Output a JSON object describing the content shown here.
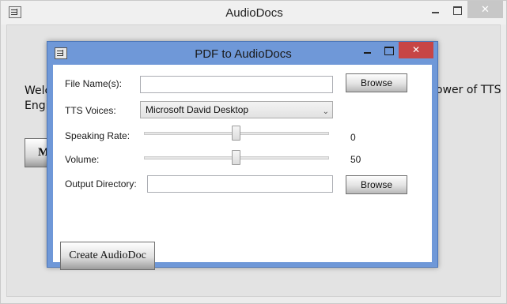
{
  "main": {
    "title": "AudioDocs",
    "close_glyph": "✕",
    "welcome_left": "Welco",
    "welcome_left_line2": "Engi",
    "welcome_right": "ower of TTS",
    "button_label": "M"
  },
  "dialog": {
    "title": "PDF to AudioDocs",
    "close_glyph": "✕",
    "file_label": "File Name(s):",
    "file_value": "",
    "browse_label": "Browse",
    "voices_label": "TTS Voices:",
    "voice_selected": "Microsoft David Desktop",
    "voice_chevron": "⌄",
    "rate_label": "Speaking Rate:",
    "rate_value": "0",
    "volume_label": "Volume:",
    "volume_value": "50",
    "output_label": "Output Directory:",
    "output_value": "",
    "browse2_label": "Browse",
    "create_label": "Create AudioDoc"
  },
  "colors": {
    "dialog_frame": "#6f98d8",
    "close_button": "#c74545"
  },
  "icons": [
    "app-icon",
    "minimize-icon",
    "maximize-icon",
    "close-icon",
    "chevron-down-icon"
  ]
}
